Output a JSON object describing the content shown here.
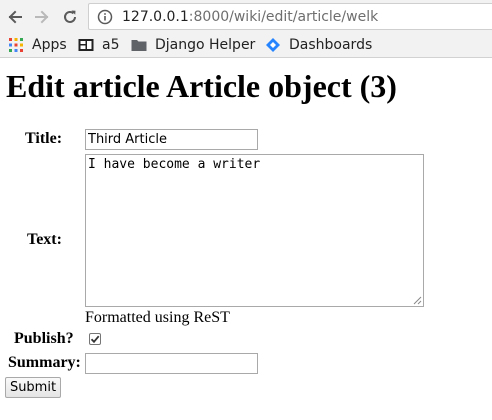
{
  "browser": {
    "url_host": "127.0.0.1",
    "url_path": ":8000/wiki/edit/article/welk",
    "bookmarks": [
      {
        "label": "Apps",
        "icon": "apps-grid-icon"
      },
      {
        "label": "a5",
        "icon": "bookmark-page-icon"
      },
      {
        "label": "Django Helper",
        "icon": "folder-icon"
      },
      {
        "label": "Dashboards",
        "icon": "jira-diamond-icon"
      }
    ]
  },
  "page": {
    "title": "Edit article Article object (3)"
  },
  "form": {
    "title_label": "Title:",
    "title_value": "Third Article",
    "text_label": "Text:",
    "text_value": "I have become a writer",
    "text_help": "Formatted using ReST",
    "publish_label": "Publish?",
    "publish_checked": true,
    "summary_label": "Summary:",
    "summary_value": "",
    "submit_label": "Submit"
  }
}
